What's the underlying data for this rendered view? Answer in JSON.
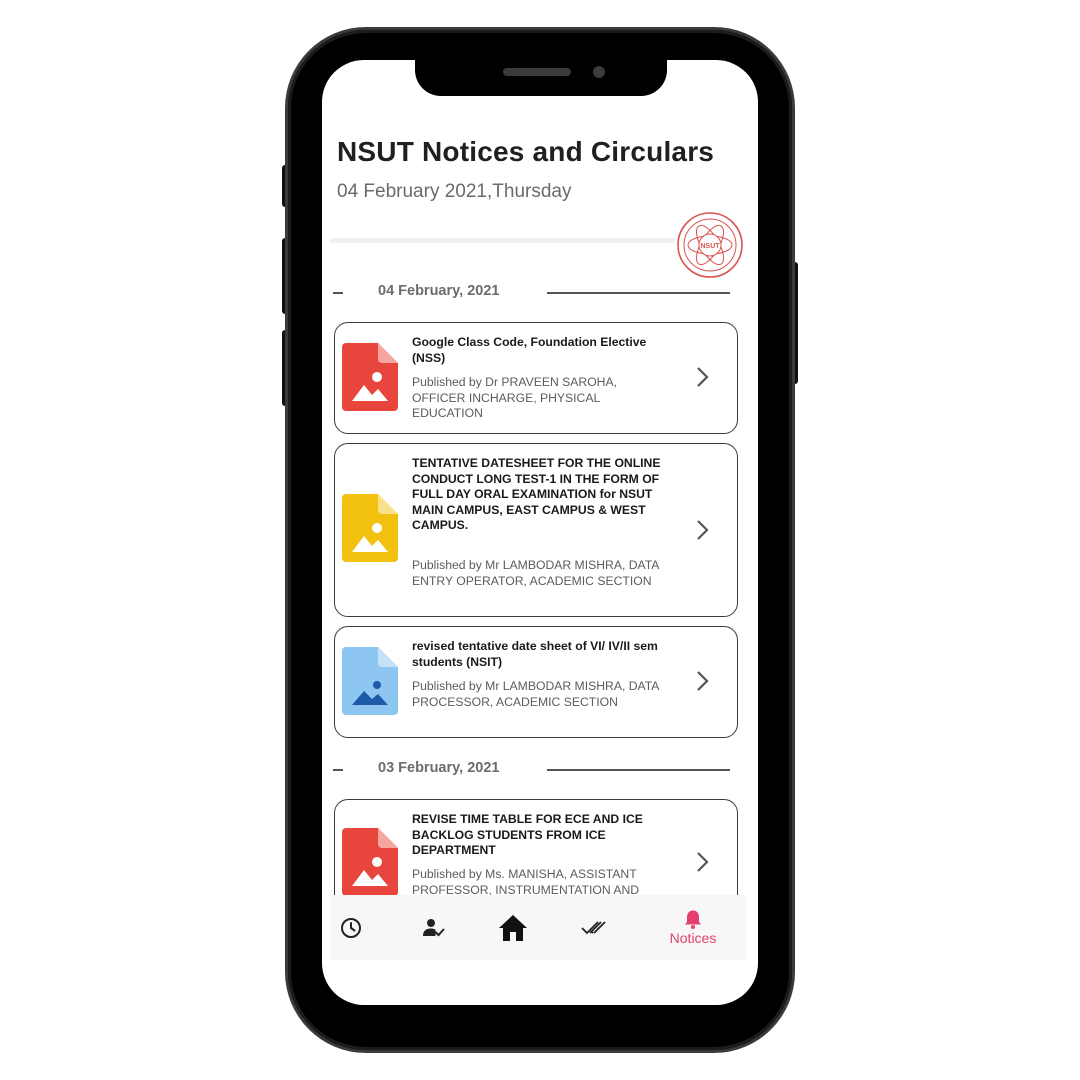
{
  "header": {
    "title": "NSUT Notices and Circulars",
    "subtitle": "04 February 2021,Thursday"
  },
  "groups": [
    {
      "date": "04 February, 2021",
      "notices": [
        {
          "title": "Google Class Code, Foundation Elective (NSS)",
          "published": "Published by Dr PRAVEEN SAROHA, OFFICER INCHARGE, PHYSICAL EDUCATION",
          "icon_color": "#e8453c"
        },
        {
          "title": "TENTATIVE DATESHEET FOR THE ONLINE CONDUCT LONG TEST-1 IN THE FORM OF FULL DAY ORAL EXAMINATION for NSUT MAIN CAMPUS, EAST CAMPUS & WEST CAMPUS.",
          "published": "Published by Mr LAMBODAR MISHRA, DATA ENTRY OPERATOR, ACADEMIC SECTION",
          "icon_color": "#f2c00e"
        },
        {
          "title": "revised tentative date sheet of VI/ IV/II sem students (NSIT)",
          "published": "Published by Mr LAMBODAR MISHRA, DATA PROCESSOR, ACADEMIC SECTION",
          "icon_color": "#8ec6f2"
        }
      ]
    },
    {
      "date": "03 February, 2021",
      "notices": [
        {
          "title": "REVISE TIME TABLE FOR ECE AND ICE BACKLOG STUDENTS FROM ICE DEPARTMENT",
          "published": "Published by Ms. MANISHA, ASSISTANT PROFESSOR, INSTRUMENTATION AND",
          "icon_color": "#e8453c"
        }
      ]
    }
  ],
  "bottom_nav": {
    "items": [
      {
        "icon": "clock-icon"
      },
      {
        "icon": "person-check-icon"
      },
      {
        "icon": "home-icon"
      },
      {
        "icon": "double-check-icon"
      },
      {
        "icon": "bell-icon",
        "label": "Notices",
        "active": true
      }
    ],
    "active_color": "#e5406d"
  },
  "logo": {
    "text": "NSUT"
  }
}
